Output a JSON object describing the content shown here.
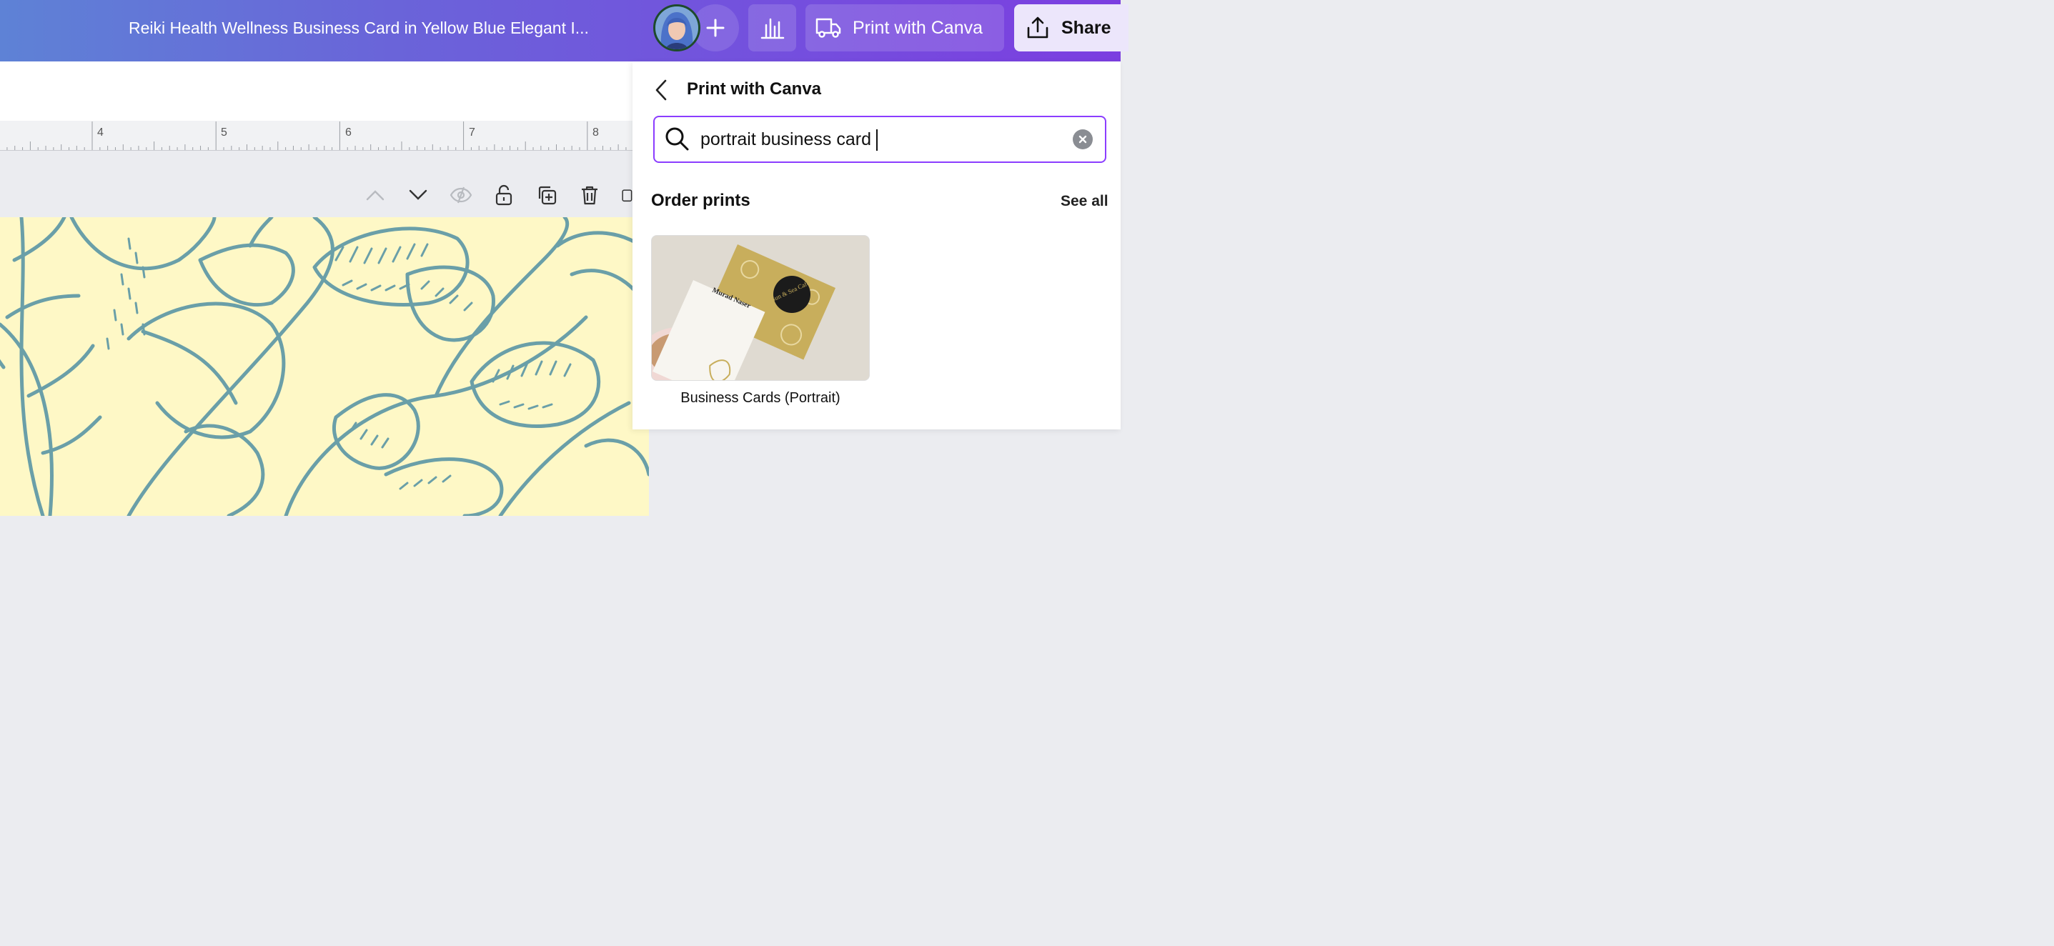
{
  "header": {
    "doc_title": "Reiki Health Wellness Business Card in Yellow Blue Elegant I...",
    "print_label": "Print with Canva",
    "share_label": "Share"
  },
  "ruler": {
    "ticks": [
      "4",
      "5",
      "6",
      "7",
      "8"
    ]
  },
  "panel": {
    "title": "Print with Canva",
    "search": {
      "value": "portrait business card"
    },
    "section_title": "Order prints",
    "see_all": "See all",
    "products": [
      {
        "label": "Business Cards (Portrait)",
        "preview_text_left": "Murad Naser",
        "preview_text_right": "Sun & Sea Cafe"
      }
    ]
  },
  "colors": {
    "accent": "#8b3dff",
    "canvas_bg": "#fef8c6",
    "line_art": "#6a9fa8"
  },
  "icons": {
    "add": "plus-icon",
    "analytics": "bar-chart-icon",
    "print": "truck-icon",
    "share": "upload-icon",
    "back": "chevron-left-icon",
    "search": "search-icon",
    "clear": "close-circle-icon"
  }
}
